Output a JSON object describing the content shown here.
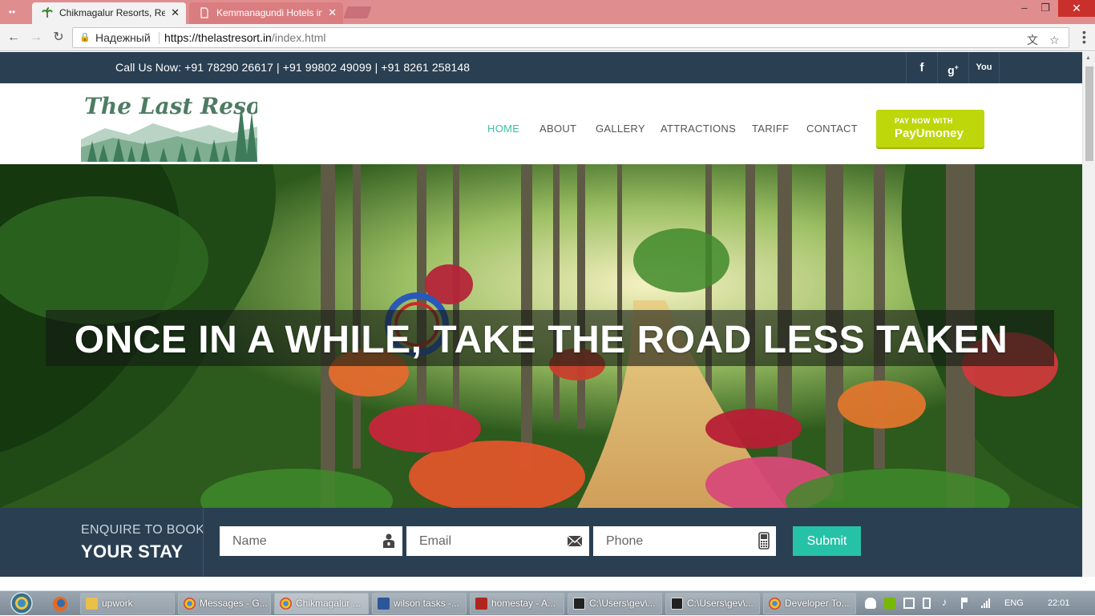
{
  "browser": {
    "tabs": [
      {
        "title": "Chikmagalur Resorts, Res",
        "active": true,
        "icon": "palm-tree-favicon"
      },
      {
        "title": "Kemmanagundi Hotels in",
        "active": false,
        "icon": "page-icon"
      }
    ],
    "omnibox": {
      "secure_label": "Надежный",
      "url_host": "https://thelastresort.in",
      "url_path": "/index.html"
    }
  },
  "site": {
    "topbar": {
      "call_text": "Call Us Now: +91 78290 26617 | +91 99802 49099 | +91 8261 258148",
      "social": [
        {
          "icon": "facebook-icon",
          "glyph": "f"
        },
        {
          "icon": "google-plus-icon",
          "glyph": "g+"
        },
        {
          "icon": "youtube-icon",
          "glyph": "You"
        }
      ]
    },
    "logo_text": "The Last Resort.in",
    "nav": [
      {
        "label": "HOME",
        "active": true
      },
      {
        "label": "ABOUT",
        "active": false
      },
      {
        "label": "GALLERY",
        "active": false
      },
      {
        "label": "ATTRACTIONS",
        "active": false
      },
      {
        "label": "TARIFF",
        "active": false
      },
      {
        "label": "CONTACT",
        "active": false
      }
    ],
    "pay_button": {
      "line1": "PAY NOW WITH",
      "line2": "PayUmoney"
    },
    "hero_title": "ONCE IN A WHILE, TAKE THE ROAD LESS TAKEN",
    "booking": {
      "heading_small": "ENQUIRE TO BOOK",
      "heading_big": "YOUR STAY",
      "name_placeholder": "Name",
      "email_placeholder": "Email",
      "phone_placeholder": "Phone",
      "submit_label": "Submit"
    }
  },
  "taskbar": {
    "items": [
      {
        "label": "upwork",
        "icon": "folder-icon",
        "active": false
      },
      {
        "label": "Messages - G...",
        "icon": "chrome-icon",
        "active": false
      },
      {
        "label": "Chikmagalur ...",
        "icon": "chrome-icon",
        "active": true
      },
      {
        "label": "wilson tasks -...",
        "icon": "word-icon",
        "active": false
      },
      {
        "label": "homestay - A...",
        "icon": "filezilla-icon",
        "active": false
      },
      {
        "label": "C:\\Users\\gev\\...",
        "icon": "console-icon",
        "active": false
      },
      {
        "label": "C:\\Users\\gev\\...",
        "icon": "console-icon",
        "active": false
      },
      {
        "label": "Developer To...",
        "icon": "chrome-icon",
        "active": false
      }
    ],
    "language": "ENG",
    "clock": "22:01"
  }
}
